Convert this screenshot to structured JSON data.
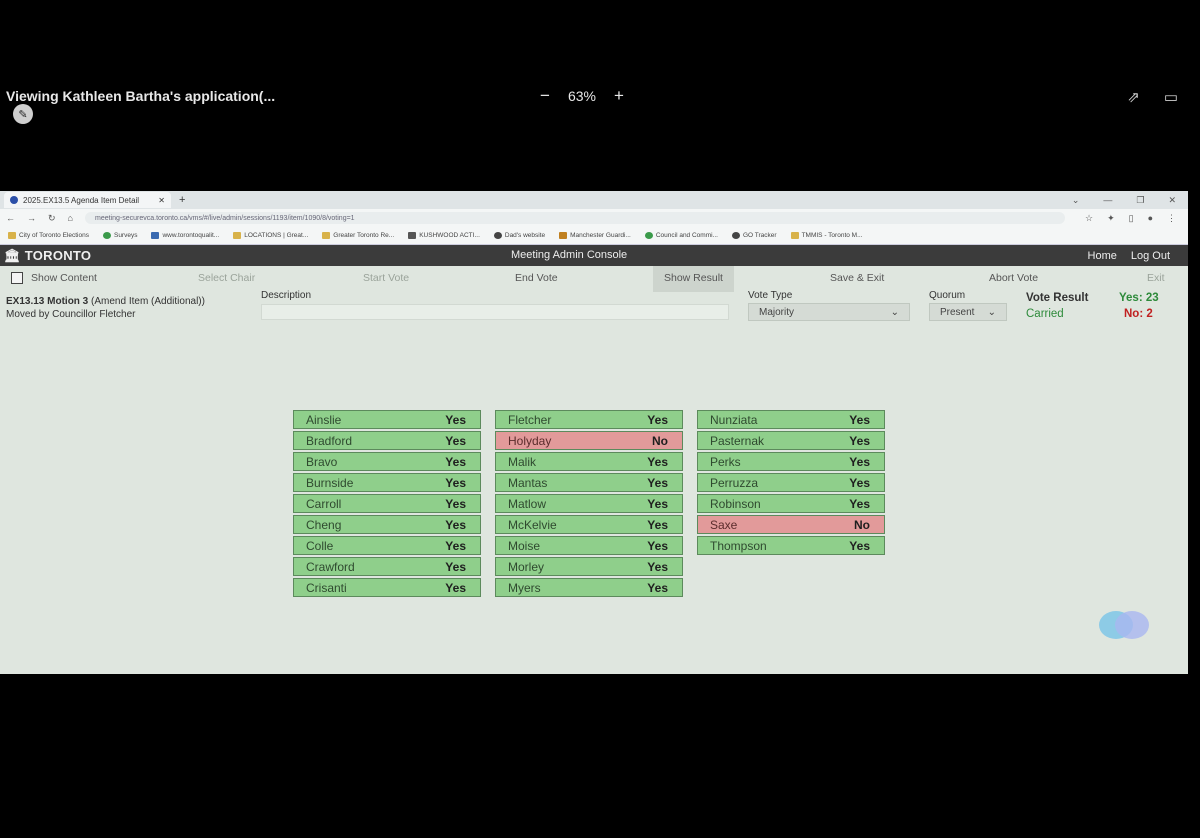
{
  "viewer": {
    "title": "Viewing Kathleen Bartha's application(...",
    "zoom_level": "63%",
    "zoom_out": "−",
    "zoom_in": "+"
  },
  "browser": {
    "tab_title": "2025.EX13.5 Agenda Item Detail",
    "url": "meeting-securevca.toronto.ca/vms/#/live/admin/sessions/1193/item/1090/8/voting=1",
    "bookmarks": [
      "City of Toronto Elections",
      "Surveys",
      "www.torontoqualit...",
      "LOCATIONS | Great...",
      "Greater Toronto Re...",
      "KUSHWOOD ACTI...",
      "Dad's website",
      "Manchester Guardi...",
      "Council and Commi...",
      "GO Tracker",
      "TMMIS - Toronto M..."
    ]
  },
  "app": {
    "logo": "TORONTO",
    "title": "Meeting Admin Console",
    "home": "Home",
    "logout": "Log Out"
  },
  "toolbar": {
    "show_content": "Show Content",
    "select_chair": "Select Chair",
    "start_vote": "Start Vote",
    "end_vote": "End Vote",
    "show_result": "Show Result",
    "save_exit": "Save & Exit",
    "abort_vote": "Abort Vote",
    "exit": "Exit"
  },
  "motion": {
    "id": "EX13.13 Motion 3",
    "type": "(Amend Item (Additional))",
    "moved_by": "Moved by Councillor Fletcher",
    "description_label": "Description",
    "description_value": "",
    "vote_type_label": "Vote Type",
    "vote_type_value": "Majority",
    "quorum_label": "Quorum",
    "quorum_value": "Present",
    "result_label": "Vote Result",
    "result_value": "Carried",
    "yes_count": "Yes: 23",
    "no_count": "No: 2"
  },
  "votes": {
    "col1": [
      {
        "name": "Ainslie",
        "vote": "Yes"
      },
      {
        "name": "Bradford",
        "vote": "Yes"
      },
      {
        "name": "Bravo",
        "vote": "Yes"
      },
      {
        "name": "Burnside",
        "vote": "Yes"
      },
      {
        "name": "Carroll",
        "vote": "Yes"
      },
      {
        "name": "Cheng",
        "vote": "Yes"
      },
      {
        "name": "Colle",
        "vote": "Yes"
      },
      {
        "name": "Crawford",
        "vote": "Yes"
      },
      {
        "name": "Crisanti",
        "vote": "Yes"
      }
    ],
    "col2": [
      {
        "name": "Fletcher",
        "vote": "Yes"
      },
      {
        "name": "Holyday",
        "vote": "No"
      },
      {
        "name": "Malik",
        "vote": "Yes"
      },
      {
        "name": "Mantas",
        "vote": "Yes"
      },
      {
        "name": "Matlow",
        "vote": "Yes"
      },
      {
        "name": "McKelvie",
        "vote": "Yes"
      },
      {
        "name": "Moise",
        "vote": "Yes"
      },
      {
        "name": "Morley",
        "vote": "Yes"
      },
      {
        "name": "Myers",
        "vote": "Yes"
      }
    ],
    "col3": [
      {
        "name": "Nunziata",
        "vote": "Yes"
      },
      {
        "name": "Pasternak",
        "vote": "Yes"
      },
      {
        "name": "Perks",
        "vote": "Yes"
      },
      {
        "name": "Perruzza",
        "vote": "Yes"
      },
      {
        "name": "Robinson",
        "vote": "Yes"
      },
      {
        "name": "Saxe",
        "vote": "No"
      },
      {
        "name": "Thompson",
        "vote": "Yes"
      }
    ]
  }
}
